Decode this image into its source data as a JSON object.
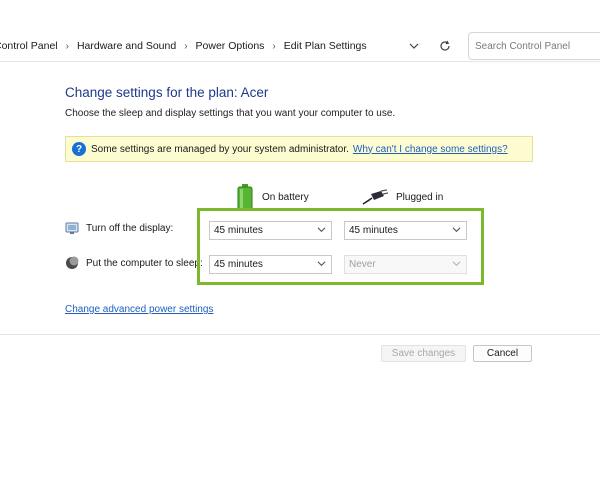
{
  "breadcrumb": {
    "items": [
      "Control Panel",
      "Hardware and Sound",
      "Power Options",
      "Edit Plan Settings"
    ],
    "separator": "›"
  },
  "search": {
    "placeholder": "Search Control Panel"
  },
  "page": {
    "title": "Change settings for the plan: Acer",
    "subtitle": "Choose the sleep and display settings that you want your computer to use."
  },
  "info_bar": {
    "text": "Some settings are managed by your system administrator.",
    "link": "Why can't I change some settings?"
  },
  "columns": {
    "battery": "On battery",
    "plugged": "Plugged in"
  },
  "rows": {
    "display": {
      "label": "Turn off the display:",
      "battery_value": "45 minutes",
      "plugged_value": "45 minutes"
    },
    "sleep": {
      "label": "Put the computer to sleep:",
      "battery_value": "45 minutes",
      "plugged_value": "Never"
    }
  },
  "advanced_link": "Change advanced power settings",
  "buttons": {
    "save": "Save changes",
    "cancel": "Cancel"
  },
  "colors": {
    "highlight": "#7ab82e",
    "link": "#1f5fbf",
    "title": "#1e3a8a",
    "info_bg": "#fdfbd0"
  },
  "icons": {
    "battery": "battery-icon",
    "plug": "power-plug-icon",
    "display": "monitor-icon",
    "sleep": "moon-icon",
    "info": "question-icon",
    "dropdown": "chevron-down-icon",
    "refresh": "refresh-icon"
  }
}
